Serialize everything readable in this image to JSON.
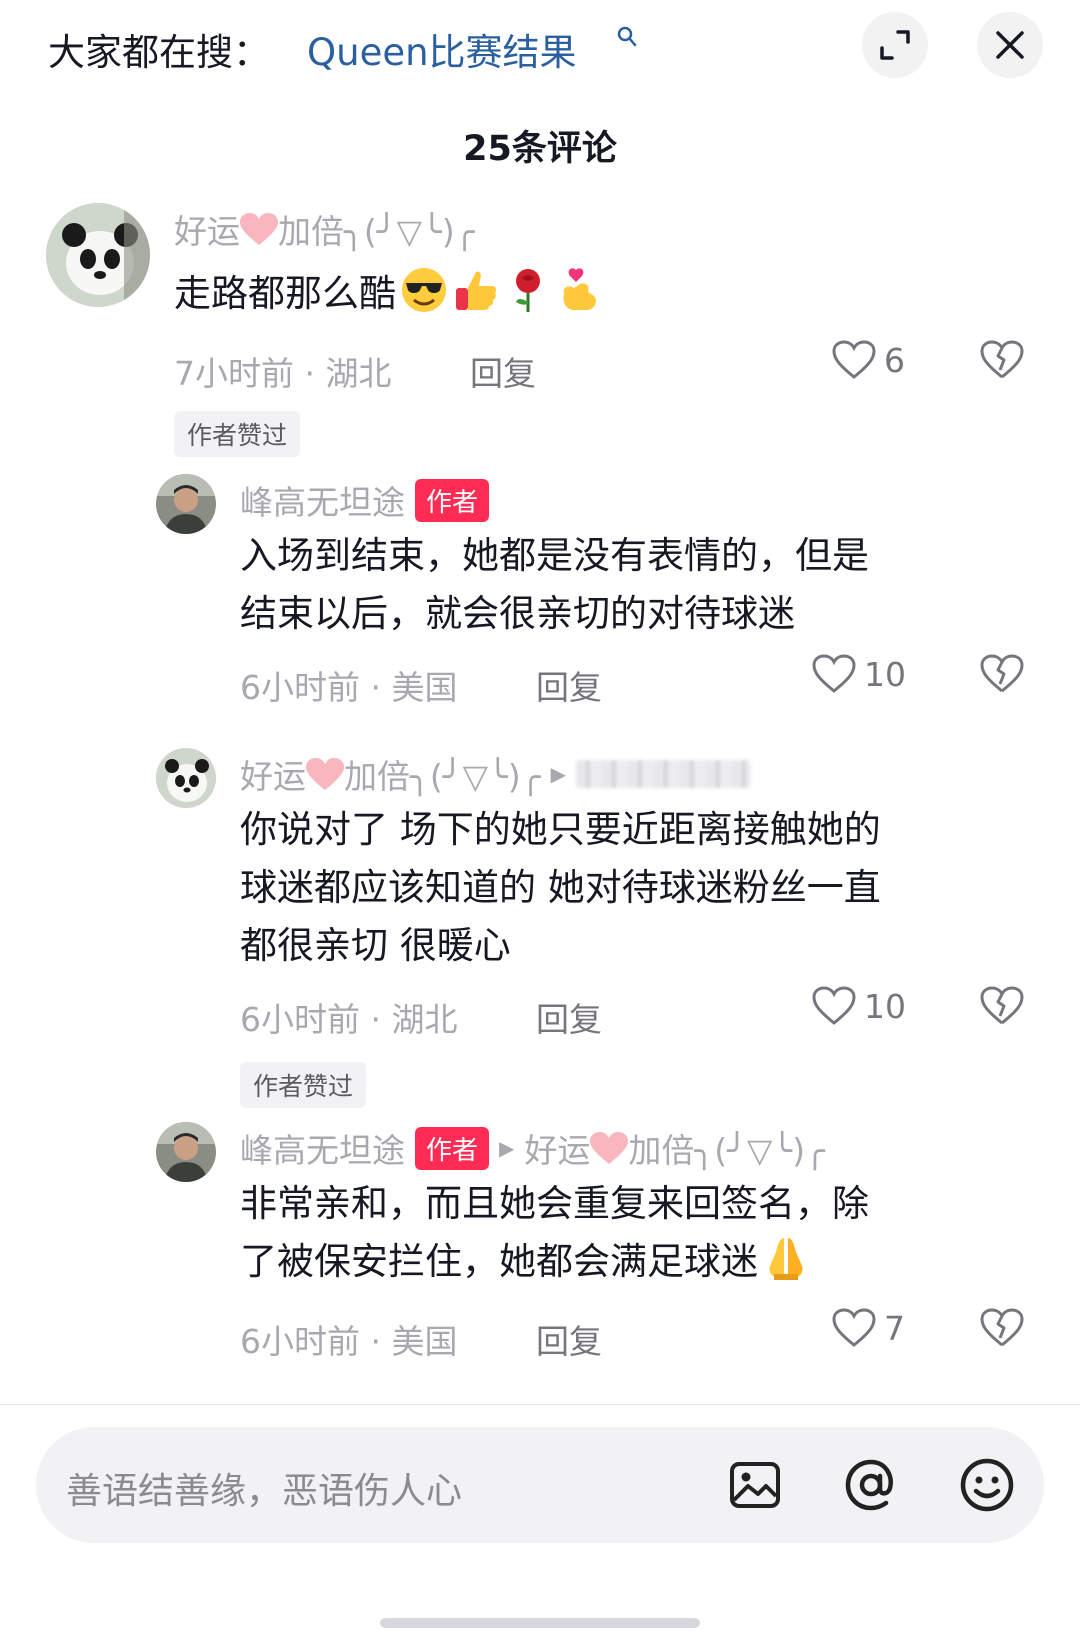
{
  "header": {
    "search_prefix": "大家都在搜：",
    "search_term": "Queen比赛结果",
    "title": "25条评论"
  },
  "comments": [
    {
      "username_a": "好运",
      "username_b": "加倍╮(╯▽╰)╭",
      "text": "走路都那么酷",
      "emojis": [
        "sunglasses-smile",
        "thumbs-up",
        "rose",
        "finger-heart"
      ],
      "time": "7小时前",
      "location": "湖北",
      "reply": "回复",
      "likes": "6",
      "liked_badge": "作者赞过"
    },
    {
      "username": "峰高无坦途",
      "author_badge": "作者",
      "text_line1": "入场到结束，她都是没有表情的，但是",
      "text_line2": "结束以后，就会很亲切的对待球迷",
      "time": "6小时前",
      "location": "美国",
      "reply": "回复",
      "likes": "10"
    },
    {
      "username_a": "好运",
      "username_b": "加倍╮(╯▽╰)╭",
      "text_line1": "你说对了 场下的她只要近距离接触她的",
      "text_line2": "球迷都应该知道的 她对待球迷粉丝一直",
      "text_line3": "都很亲切 很暖心",
      "time": "6小时前",
      "location": "湖北",
      "reply": "回复",
      "likes": "10",
      "liked_badge": "作者赞过"
    },
    {
      "username": "峰高无坦途",
      "author_badge": "作者",
      "reply_to_a": "好运",
      "reply_to_b": "加倍╮(╯▽╰)╭",
      "text_line1": "非常亲和，而且她会重复来回签名，除",
      "text_line2": "了被保安拦住，她都会满足球迷",
      "time": "6小时前",
      "location": "美国",
      "reply": "回复",
      "likes": "7"
    }
  ],
  "footer": {
    "input_placeholder": "善语结善缘，恶语伤人心"
  },
  "colors": {
    "accent_link": "#2a5fa0",
    "author_badge": "#fe2c55",
    "muted_text": "#a8a9ae"
  }
}
